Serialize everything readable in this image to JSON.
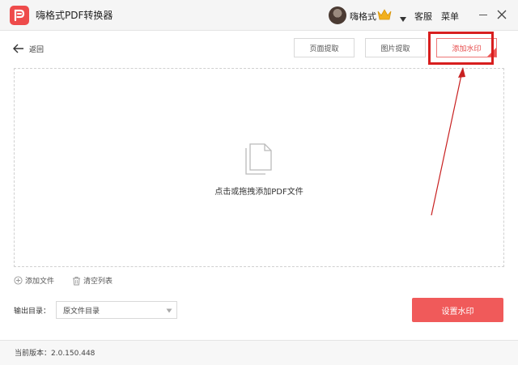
{
  "app": {
    "title": "嗨格式PDF转换器"
  },
  "header": {
    "username": "嗨格式",
    "service_label": "客服",
    "menu_label": "菜单"
  },
  "toolbar": {
    "back_label": "返回",
    "page_extract_label": "页面提取",
    "image_extract_label": "图片提取",
    "add_watermark_label": "添加水印"
  },
  "dropzone": {
    "hint": "点击或拖拽添加PDF文件"
  },
  "actions": {
    "add_file_label": "添加文件",
    "clear_list_label": "清空列表",
    "output_dir_label": "输出目录：",
    "output_dir_value": "原文件目录",
    "set_watermark_label": "设置水印"
  },
  "footer": {
    "version": "当前版本：2.0.150.448"
  },
  "colors": {
    "accent": "#f05a5a",
    "highlight": "#d81e1e",
    "crown": "#f2b01e"
  }
}
